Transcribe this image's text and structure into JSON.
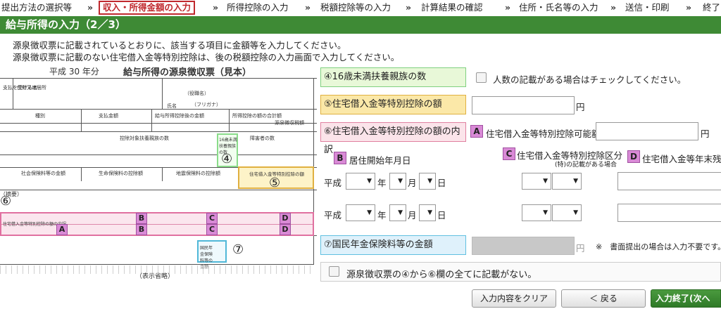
{
  "steps": {
    "s1": "提出方法の選択等",
    "s2": "収入・所得金額の入力",
    "s3": "所得控除の入力",
    "s4": "税額控除等の入力",
    "s5": "計算結果の確認",
    "s6": "住所・氏名等の入力",
    "s7": "送信・印刷",
    "s8": "終了",
    "sep": "»"
  },
  "title": "給与所得の入力（2／3）",
  "instructions": {
    "line1": "源泉徴収票に記載されているとおりに、該当する項目に金額等を入力してください。",
    "line2": "源泉徴収票に記載のない住宅借入金等特別控除は、後の税額控除の入力画面で入力してください。"
  },
  "form_image": {
    "heading_era": "平成 30 年分",
    "heading_title": "給与所得の源泉徴収票（見本）",
    "caption": "（表示省略）",
    "labels": {
      "payee": "支払を受ける者",
      "address": "住所又は居所",
      "role": "（役職名）",
      "furigana": "（フリガナ）",
      "name": "氏名",
      "type": "種別",
      "payment": "支払金額",
      "after_deduction": "給与所得控除後の金額",
      "deduction_total": "所得控除の額の合計額",
      "tax": "源泉徴収税額",
      "dependents": "控除対象扶養親族の数",
      "disabled": "障害者の数",
      "under16": "16歳未満扶養親族の数",
      "social_ins": "社会保険料等の金額",
      "life_ins": "生命保険料の控除額",
      "quake_ins": "地震保険料の控除額",
      "housing": "住宅借入金等特別控除の額",
      "summary": "（摘要）",
      "housing_breakdown": "住宅借入金等特別控除の額の内訳",
      "pension": "国民年金保険料等の金額",
      "yen": "円"
    },
    "markers": {
      "a": "A",
      "b": "B",
      "c": "C",
      "d": "D"
    },
    "circles": {
      "c4": "④",
      "c5": "⑤",
      "c6": "⑥",
      "c7": "⑦"
    }
  },
  "fields": {
    "under16": {
      "label": "④16歳未満扶養親族の数",
      "checkbox_label": "人数の記載がある場合はチェックしてください。"
    },
    "housing_amount": {
      "label": "⑤住宅借入金等特別控除の額",
      "unit": "円"
    },
    "housing_breakdown": {
      "label": "⑥住宅借入金等特別控除の額の内訳",
      "a_marker": "A",
      "a_label": "住宅借入金等特別控除可能額",
      "a_unit": "円",
      "b_marker": "B",
      "b_label": "居住開始年月日",
      "c_marker": "C",
      "c_label": "住宅借入金等特別控除区分",
      "c_note": "(特)の記載がある場合",
      "d_marker": "D",
      "d_label": "住宅借入金等年末残高",
      "era": "平成",
      "year": "年",
      "month": "月",
      "day": "日",
      "dropdown_arrow": "▼"
    },
    "pension": {
      "label": "⑦国民年金保険料等の金額",
      "unit": "円",
      "note": "※　書面提出の場合は入力不要です。"
    },
    "none_checkbox_label": "源泉徴収票の④から⑥欄の全てに記載がない。"
  },
  "buttons": {
    "clear": "入力内容をクリア",
    "back": "＜ 戻る",
    "next": "入力終了(次へ"
  },
  "colors": {
    "green_header": "#3e8a35",
    "current_step": "#c0282d",
    "marker": "#d98ad6"
  }
}
